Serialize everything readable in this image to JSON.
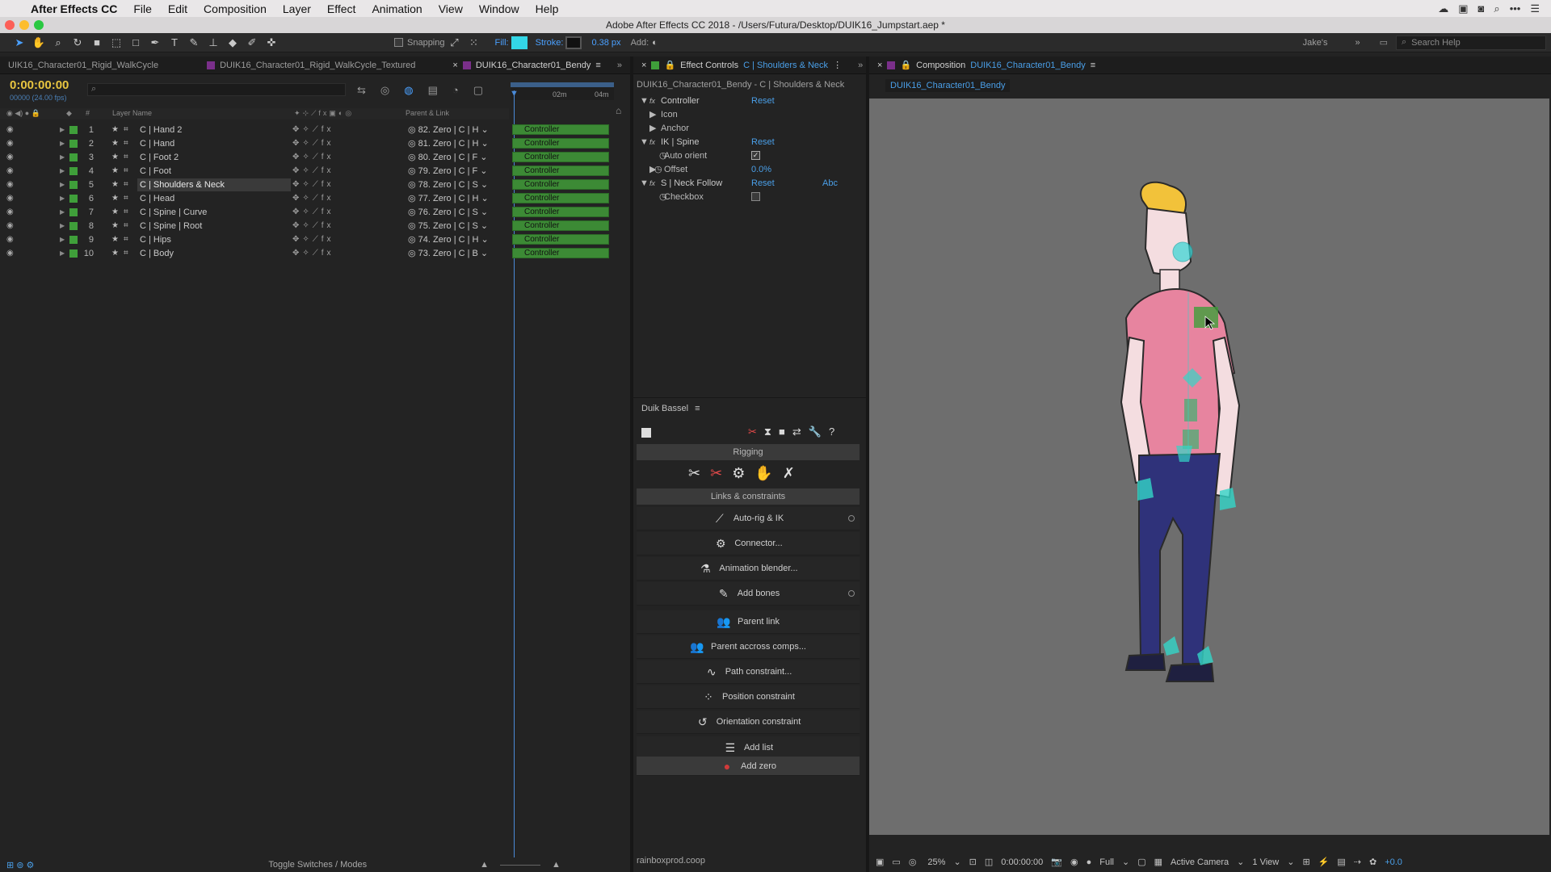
{
  "menubar": {
    "app_name": "After Effects CC",
    "items": [
      "File",
      "Edit",
      "Composition",
      "Layer",
      "Effect",
      "Animation",
      "View",
      "Window",
      "Help"
    ]
  },
  "window_title": "Adobe After Effects CC 2018 - /Users/Futura/Desktop/DUIK16_Jumpstart.aep *",
  "toolbar": {
    "snapping_label": "Snapping",
    "fill_label": "Fill:",
    "stroke_label": "Stroke:",
    "stroke_width": "0.38 px",
    "add_label": "Add:",
    "workspace": "Jake's",
    "search_placeholder": "Search Help",
    "fill_color": "#33d6e6"
  },
  "timeline": {
    "tabs": [
      "UIK16_Character01_Rigid_WalkCycle",
      "DUIK16_Character01_Rigid_WalkCycle_Textured",
      "DUIK16_Character01_Bendy"
    ],
    "timecode": "0:00:00:00",
    "timecode_sub": "00000 (24.00 fps)",
    "col_layer_name": "Layer Name",
    "col_parent": "Parent & Link",
    "col_hash": "#",
    "ruler_02": "02m",
    "ruler_04": "04m",
    "bar_label": "Controller",
    "layers": [
      {
        "num": "1",
        "name": "C | Hand 2",
        "parent": "82. Zero | C | H"
      },
      {
        "num": "2",
        "name": "C | Hand",
        "parent": "81. Zero | C | H"
      },
      {
        "num": "3",
        "name": "C | Foot 2",
        "parent": "80. Zero | C | F"
      },
      {
        "num": "4",
        "name": "C | Foot",
        "parent": "79. Zero | C | F"
      },
      {
        "num": "5",
        "name": "C | Shoulders & Neck",
        "parent": "78. Zero | C | S"
      },
      {
        "num": "6",
        "name": "C | Head",
        "parent": "77. Zero | C | H"
      },
      {
        "num": "7",
        "name": "C | Spine | Curve",
        "parent": "76. Zero | C | S"
      },
      {
        "num": "8",
        "name": "C | Spine | Root",
        "parent": "75. Zero | C | S"
      },
      {
        "num": "9",
        "name": "C | Hips",
        "parent": "74. Zero | C | H"
      },
      {
        "num": "10",
        "name": "C | Body",
        "parent": "73. Zero | C | B"
      }
    ],
    "toggle_label": "Toggle Switches / Modes"
  },
  "effect_controls": {
    "tab_prefix": "Effect Controls",
    "tab_layer": "C | Shoulders & Neck",
    "path": "DUIK16_Character01_Bendy - C | Shoulders & Neck",
    "reset": "Reset",
    "controller": "Controller",
    "icon": "Icon",
    "anchor": "Anchor",
    "ik_spine": "IK | Spine",
    "auto_orient": "Auto orient",
    "offset": "Offset",
    "offset_value": "0.0%",
    "neck_follow": "S | Neck Follow",
    "abc": "Abc",
    "checkbox": "Checkbox"
  },
  "duik": {
    "title": "Duik Bassel",
    "rigging": "Rigging",
    "links": "Links & constraints",
    "buttons": [
      "Auto-rig & IK",
      "Connector...",
      "Animation blender...",
      "Add bones",
      "Parent link",
      "Parent accross comps...",
      "Path constraint...",
      "Position constraint",
      "Orientation constraint",
      "Add list",
      "Add zero"
    ],
    "footer": "rainboxprod.coop"
  },
  "composition": {
    "tab_prefix": "Composition",
    "tab_name": "DUIK16_Character01_Bendy",
    "subtab": "DUIK16_Character01_Bendy",
    "zoom": "25%",
    "timecode": "0:00:00:00",
    "resolution": "Full",
    "camera": "Active Camera",
    "views": "1 View",
    "exposure": "+0.0"
  }
}
